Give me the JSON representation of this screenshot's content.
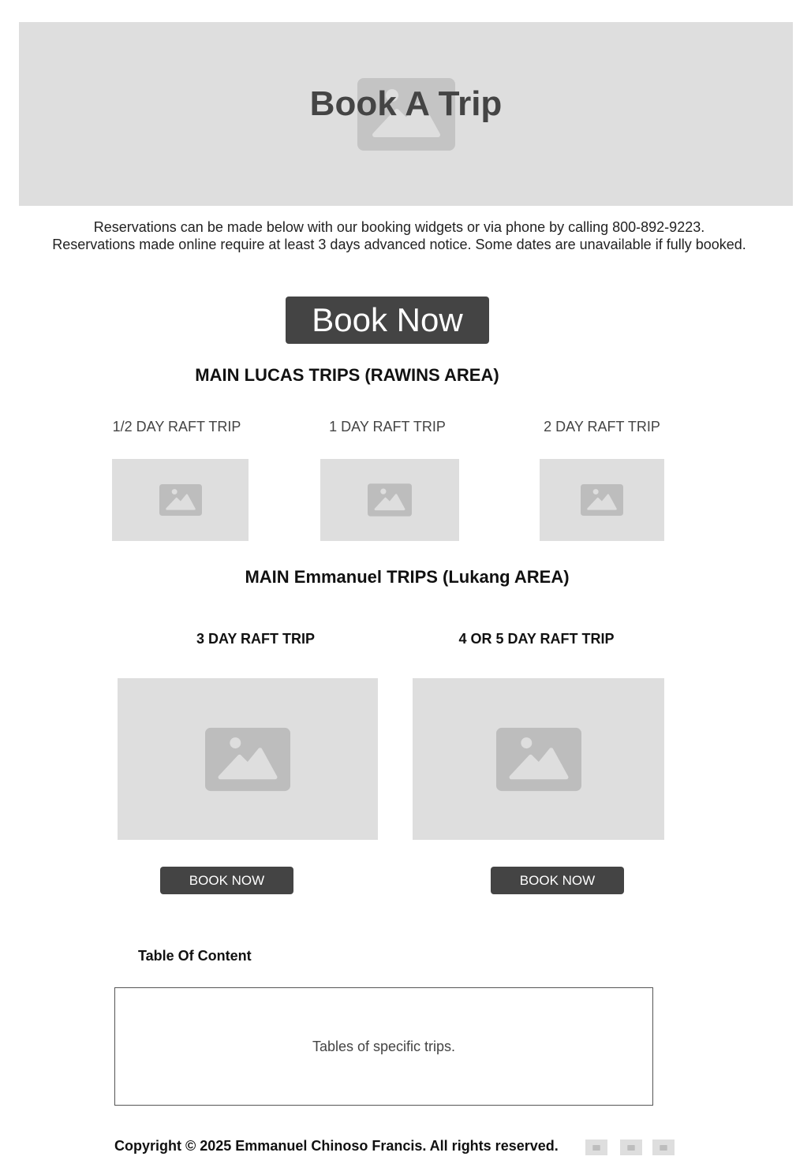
{
  "hero": {
    "title": "Book A Trip"
  },
  "intro": {
    "line1": "Reservations can be made below with our booking widgets or via phone by calling 800-892-9223.",
    "line2": "Reservations made online require at least 3 days advanced notice. Some dates are unavailable if fully booked."
  },
  "book_now": {
    "label": "Book Now"
  },
  "section_lucas": {
    "title": "MAIN LUCAS TRIPS (RAWINS AREA)",
    "trips": [
      {
        "label": "1/2 DAY RAFT TRIP"
      },
      {
        "label": "1 DAY RAFT TRIP"
      },
      {
        "label": "2 DAY RAFT TRIP"
      }
    ]
  },
  "section_emmanuel": {
    "title": "MAIN Emmanuel TRIPS (Lukang AREA)",
    "trips": [
      {
        "label": "3 DAY RAFT TRIP",
        "button": "BOOK NOW"
      },
      {
        "label": "4 OR 5 DAY RAFT TRIP",
        "button": "BOOK NOW"
      }
    ]
  },
  "toc": {
    "title": "Table Of Content",
    "body": "Tables of specific trips."
  },
  "footer": {
    "copyright": "Copyright © 2025 Emmanuel Chinoso Francis. All rights reserved.",
    "social_icons": [
      "social-icon-1",
      "social-icon-2",
      "social-icon-3"
    ]
  },
  "colors": {
    "placeholder_bg": "#dedede",
    "placeholder_icon": "#bdbdbd",
    "button_bg": "#444444",
    "button_text": "#ffffff"
  }
}
